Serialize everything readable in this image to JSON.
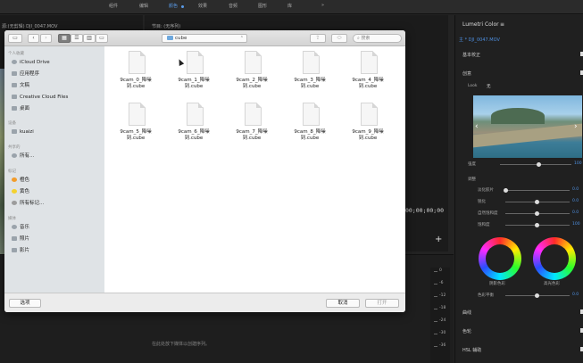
{
  "app": {
    "menu": [
      "组件",
      "编辑",
      "颜色",
      "效果",
      "音频",
      "图形",
      "库"
    ],
    "active_menu": "颜色",
    "more": "»"
  },
  "source_panel": {
    "title": "源:(无剪辑) DJI_0047.MOV"
  },
  "program_panel": {
    "title": "节目: (无序列)",
    "timecode": "00;00;00;00",
    "add": "+"
  },
  "timeline": {
    "hint": "在此处放下媒体以创建序列。",
    "meter_ticks": [
      "0",
      "-6",
      "-12",
      "-18",
      "-24",
      "-30",
      "-36"
    ]
  },
  "lumetri": {
    "title": "Lumetri Color",
    "title_mark": "≡",
    "clip": "主 * DJI_0047.MOV",
    "basic": "基本校正",
    "creative": "创意",
    "look_label": "Look",
    "look_value": "无",
    "intensity_label": "强度",
    "intensity_value": "100",
    "adjust": "调整",
    "sliders": [
      {
        "label": "淡化胶片",
        "value": "0.0",
        "pos": 0
      },
      {
        "label": "锐化",
        "value": "0.0",
        "pos": 0.5
      },
      {
        "label": "自然饱和度",
        "value": "0.0",
        "pos": 0.5
      },
      {
        "label": "饱和度",
        "value": "100",
        "pos": 0.5
      }
    ],
    "wheel_shadow": "阴影色彩",
    "wheel_highlight": "高光色彩",
    "tint_balance_label": "色彩平衡",
    "tint_balance_value": "0.0",
    "curves": "曲线",
    "wheels": "色轮",
    "hsl": "HSL 辅助"
  },
  "dialog": {
    "toolbar": {
      "sidebar_toggle": "▭",
      "back": "‹",
      "forward": "›",
      "view_icons": "▦",
      "view_list": "☰",
      "view_columns": "▥",
      "view_cover": "▭",
      "arrange": "▤ ▾",
      "share": "⇪",
      "tags": "⬭",
      "folder": "cube",
      "search_placeholder": "搜索"
    },
    "sidebar": {
      "sec_personal": "个人收藏",
      "icloud": "iCloud Drive",
      "apps": "应用程序",
      "docs": "文稿",
      "ccf": "Creative Cloud Files",
      "desktop": "桌面",
      "sec_devices": "设备",
      "kuaizi": "kuaizi",
      "sec_shared": "共享的",
      "all": "所有...",
      "sec_tags": "标记",
      "orange": "橙色",
      "yellow": "黄色",
      "alltags": "所有标记...",
      "sec_media": "媒体",
      "music": "音乐",
      "photos": "照片",
      "movies": "影片"
    },
    "files": [
      [
        "9cam_0_降噪",
        "到.cube"
      ],
      [
        "9cam_1_降噪",
        "到.cube"
      ],
      [
        "9cam_2_降噪",
        "到.cube"
      ],
      [
        "9cam_3_降噪",
        "到.cube"
      ],
      [
        "9cam_4_降噪",
        "到.cube"
      ],
      [
        "9cam_5_降噪",
        "到.cube"
      ],
      [
        "9cam_6_降噪",
        "到.cube"
      ],
      [
        "9cam_7_降噪",
        "到.cube"
      ],
      [
        "9cam_8_降噪",
        "到.cube"
      ],
      [
        "9cam_9_降噪",
        "到.cube"
      ]
    ],
    "options": "选项",
    "cancel": "取消",
    "open": "打开"
  }
}
